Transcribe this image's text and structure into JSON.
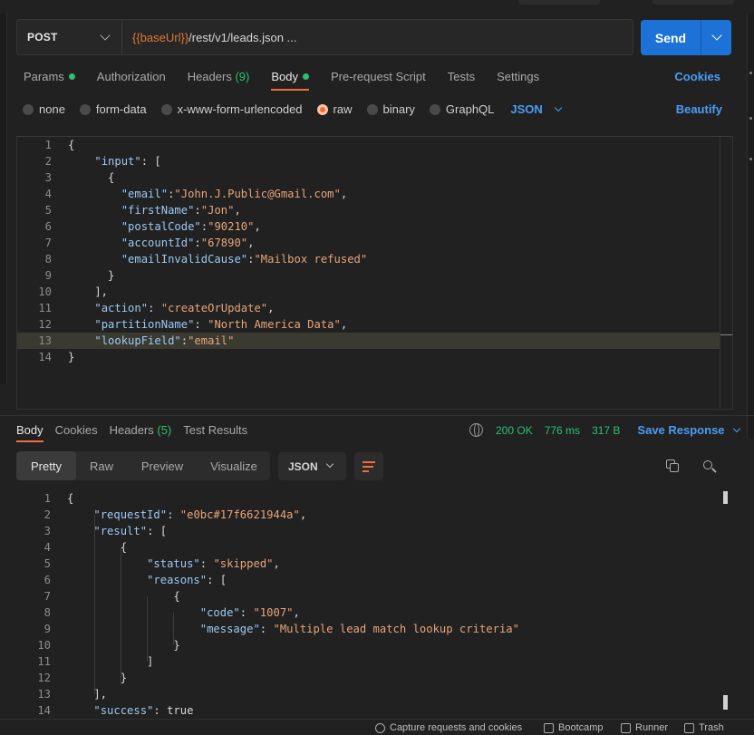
{
  "request": {
    "method": "POST",
    "url_var": "{{baseUrl}}",
    "url_path": "/rest/v1/leads.json ...",
    "send_label": "Send"
  },
  "request_tabs": [
    {
      "label": "Params",
      "dot": true
    },
    {
      "label": "Authorization"
    },
    {
      "label": "Headers",
      "count": "(9)"
    },
    {
      "label": "Body",
      "dot": true,
      "active": true
    },
    {
      "label": "Pre-request Script"
    },
    {
      "label": "Tests"
    },
    {
      "label": "Settings"
    }
  ],
  "cookies_label": "Cookies",
  "body_types": [
    {
      "label": "none"
    },
    {
      "label": "form-data"
    },
    {
      "label": "x-www-form-urlencoded"
    },
    {
      "label": "raw",
      "selected": true
    },
    {
      "label": "binary"
    },
    {
      "label": "GraphQL"
    }
  ],
  "raw_format": "JSON",
  "beautify_label": "Beautify",
  "request_body": [
    {
      "n": "1",
      "t": "{"
    },
    {
      "n": "2",
      "t": "    \"input\": ["
    },
    {
      "n": "3",
      "t": "      {"
    },
    {
      "n": "4",
      "t": "        \"email\":\"John.J.Public@Gmail.com\","
    },
    {
      "n": "5",
      "t": "        \"firstName\":\"Jon\","
    },
    {
      "n": "6",
      "t": "        \"postalCode\":\"90210\","
    },
    {
      "n": "7",
      "t": "        \"accountId\":\"67890\","
    },
    {
      "n": "8",
      "t": "        \"emailInvalidCause\":\"Mailbox refused\""
    },
    {
      "n": "9",
      "t": "      }"
    },
    {
      "n": "10",
      "t": "    ],"
    },
    {
      "n": "11",
      "t": "    \"action\": \"createOrUpdate\","
    },
    {
      "n": "12",
      "t": "    \"partitionName\": \"North America Data\","
    },
    {
      "n": "13",
      "t": "    \"lookupField\":\"email\""
    },
    {
      "n": "14",
      "t": "}"
    }
  ],
  "response_tabs": [
    {
      "label": "Body",
      "active": true
    },
    {
      "label": "Cookies"
    },
    {
      "label": "Headers",
      "count": "(5)"
    },
    {
      "label": "Test Results"
    }
  ],
  "response_meta": {
    "status": "200 OK",
    "time": "776 ms",
    "size": "317 B",
    "save_label": "Save Response"
  },
  "view_modes": [
    "Pretty",
    "Raw",
    "Preview",
    "Visualize"
  ],
  "response_format": "JSON",
  "response_body": [
    {
      "n": "1",
      "t": "{"
    },
    {
      "n": "2",
      "t": "    \"requestId\": \"e0bc#17f6621944a\","
    },
    {
      "n": "3",
      "t": "    \"result\": ["
    },
    {
      "n": "4",
      "t": "        {"
    },
    {
      "n": "5",
      "t": "            \"status\": \"skipped\","
    },
    {
      "n": "6",
      "t": "            \"reasons\": ["
    },
    {
      "n": "7",
      "t": "                {"
    },
    {
      "n": "8",
      "t": "                    \"code\": \"1007\","
    },
    {
      "n": "9",
      "t": "                    \"message\": \"Multiple lead match lookup criteria\""
    },
    {
      "n": "10",
      "t": "                }"
    },
    {
      "n": "11",
      "t": "            ]"
    },
    {
      "n": "12",
      "t": "        }"
    },
    {
      "n": "13",
      "t": "    ],"
    },
    {
      "n": "14",
      "t": "    \"success\": true"
    }
  ],
  "status_bar": {
    "capture": "Capture requests and cookies",
    "bootcamp": "Bootcamp",
    "runner": "Runner",
    "trash": "Trash"
  }
}
